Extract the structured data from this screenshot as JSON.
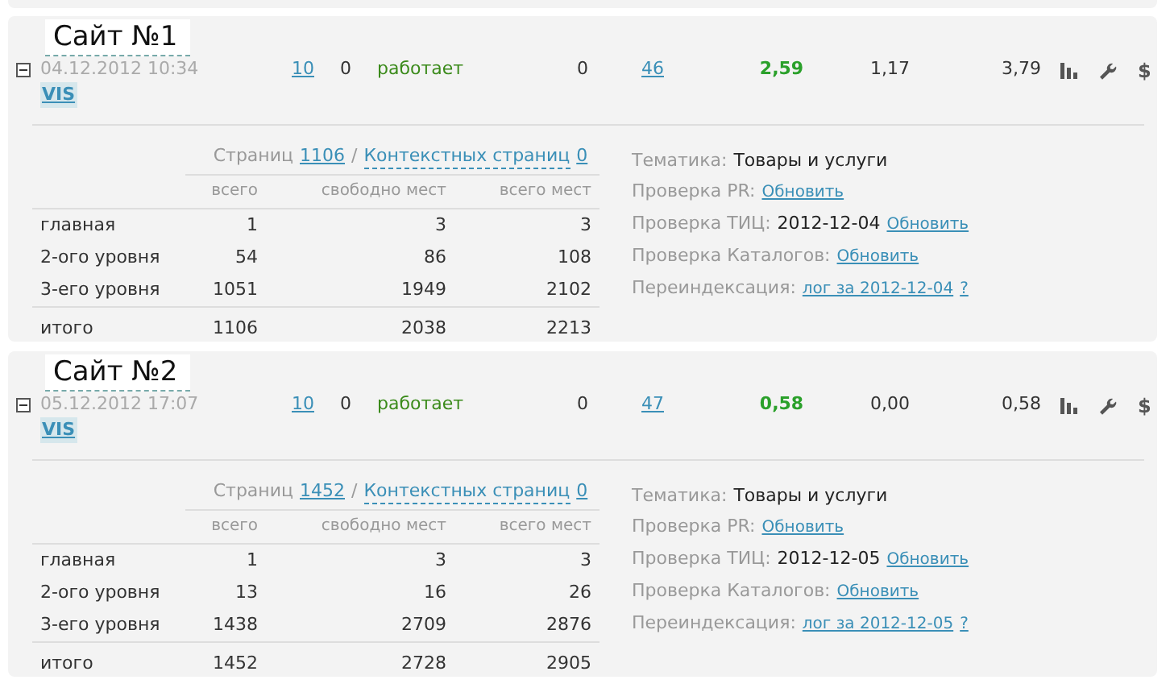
{
  "sites": [
    {
      "label": "Сайт №1",
      "expanded": true,
      "date": "04.12.2012 10:34",
      "tag": "VIS",
      "cells": [
        {
          "kind": "link",
          "text": "10"
        },
        {
          "kind": "plain",
          "text": "0"
        },
        {
          "kind": "status",
          "text": "работает"
        },
        {
          "kind": "plain",
          "text": "0"
        },
        {
          "kind": "link",
          "text": "46"
        },
        {
          "kind": "highlight",
          "text": "2,59"
        },
        {
          "kind": "plain",
          "text": "1,17"
        },
        {
          "kind": "plain",
          "text": "3,79"
        }
      ],
      "actions": [
        {
          "kind": "chart"
        },
        {
          "kind": "wrench"
        },
        {
          "kind": "text",
          "text": "$"
        }
      ],
      "pages": {
        "label": "Страниц",
        "count": "1106",
        "separator": "/",
        "context_label": "Контекстных страниц",
        "context_count": "0"
      },
      "columns": [
        "всего",
        "свободно мест",
        "всего мест"
      ],
      "rows": [
        {
          "label": "главная",
          "values": [
            "1",
            "3",
            "3"
          ]
        },
        {
          "label": "2-ого уровня",
          "values": [
            "54",
            "86",
            "108"
          ]
        },
        {
          "label": "3-его уровня",
          "values": [
            "1051",
            "1949",
            "2102"
          ]
        }
      ],
      "total": {
        "label": "итого",
        "values": [
          "1106",
          "2038",
          "2213"
        ]
      },
      "info": [
        {
          "label": "Тематика:",
          "value": "Товары и услуги"
        },
        {
          "label": "Проверка PR:",
          "links": [
            "Обновить"
          ]
        },
        {
          "label": "Проверка ТИЦ:",
          "value": "2012-12-04",
          "links": [
            "Обновить"
          ]
        },
        {
          "label": "Проверка Каталогов:",
          "links": [
            "Обновить"
          ]
        },
        {
          "label": "Переиндексация:",
          "links": [
            "лог за 2012-12-04",
            "?"
          ]
        }
      ]
    },
    {
      "label": "Сайт №2",
      "expanded": true,
      "date": "05.12.2012 17:07",
      "tag": "VIS",
      "cells": [
        {
          "kind": "link",
          "text": "10"
        },
        {
          "kind": "plain",
          "text": "0"
        },
        {
          "kind": "status",
          "text": "работает"
        },
        {
          "kind": "plain",
          "text": "0"
        },
        {
          "kind": "link",
          "text": "47"
        },
        {
          "kind": "highlight",
          "text": "0,58"
        },
        {
          "kind": "plain",
          "text": "0,00"
        },
        {
          "kind": "plain",
          "text": "0,58"
        }
      ],
      "actions": [
        {
          "kind": "chart"
        },
        {
          "kind": "wrench"
        },
        {
          "kind": "text",
          "text": "$"
        }
      ],
      "pages": {
        "label": "Страниц",
        "count": "1452",
        "separator": "/",
        "context_label": "Контекстных страниц",
        "context_count": "0"
      },
      "columns": [
        "всего",
        "свободно мест",
        "всего мест"
      ],
      "rows": [
        {
          "label": "главная",
          "values": [
            "1",
            "3",
            "3"
          ]
        },
        {
          "label": "2-ого уровня",
          "values": [
            "13",
            "16",
            "26"
          ]
        },
        {
          "label": "3-его уровня",
          "values": [
            "1438",
            "2709",
            "2876"
          ]
        }
      ],
      "total": {
        "label": "итого",
        "values": [
          "1452",
          "2728",
          "2905"
        ]
      },
      "info": [
        {
          "label": "Тематика:",
          "value": "Товары и услуги"
        },
        {
          "label": "Проверка PR:",
          "links": [
            "Обновить"
          ]
        },
        {
          "label": "Проверка ТИЦ:",
          "value": "2012-12-05",
          "links": [
            "Обновить"
          ]
        },
        {
          "label": "Проверка Каталогов:",
          "links": [
            "Обновить"
          ]
        },
        {
          "label": "Переиндексация:",
          "links": [
            "лог за 2012-12-05",
            "?"
          ]
        }
      ]
    }
  ]
}
